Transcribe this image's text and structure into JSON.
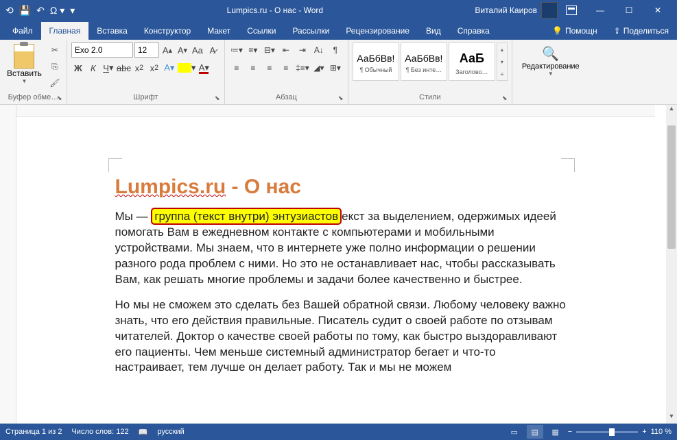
{
  "titlebar": {
    "title": "Lumpics.ru - О нас  -  Word",
    "user": "Виталий Каиров"
  },
  "tabs": {
    "items": [
      "Файл",
      "Главная",
      "Вставка",
      "Конструктор",
      "Макет",
      "Ссылки",
      "Рассылки",
      "Рецензирование",
      "Вид",
      "Справка"
    ],
    "active_index": 1,
    "help_q": "Помощн",
    "share": "Поделиться"
  },
  "ribbon": {
    "clipboard": {
      "label": "Буфер обме…",
      "paste": "Вставить"
    },
    "font": {
      "label": "Шрифт",
      "font_name": "Exo 2.0",
      "font_size": "12",
      "clear_fmt": "Aa"
    },
    "paragraph": {
      "label": "Абзац"
    },
    "styles": {
      "label": "Стили",
      "items": [
        {
          "preview": "АаБбВв!",
          "name": "¶ Обычный"
        },
        {
          "preview": "АаБбВв!",
          "name": "¶ Без инте…"
        },
        {
          "preview": "АаБ",
          "name": "Заголово…"
        }
      ]
    },
    "editing": {
      "label": "Редактирование"
    }
  },
  "document": {
    "title_part1": "Lumpics.ru",
    "title_part2": " - О нас",
    "p1_before": "Мы — ",
    "p1_highlight": "группа (текст внутри) энтузиастов",
    "p1_after": "екст за выделением, одержимых идеей помогать Вам в ежедневном контакте с компьютерами и мобильными устройствами. Мы знаем, что в интернете уже полно информации о решении разного рода проблем с ними. Но это не останавливает нас, чтобы рассказывать Вам, как решать многие проблемы и задачи более качественно и быстрее.",
    "p2": "Но мы не сможем это сделать без Вашей обратной связи. Любому человеку важно знать, что его действия правильные. Писатель судит о своей работе по отзывам читателей. Доктор о качестве своей работы по тому, как быстро выздоравливают его пациенты. Чем меньше системный администратор бегает и что-то настраивает, тем лучше он делает работу. Так и мы не можем"
  },
  "statusbar": {
    "page": "Страница 1 из 2",
    "words": "Число слов: 122",
    "lang": "русский",
    "zoom": "110 %"
  }
}
